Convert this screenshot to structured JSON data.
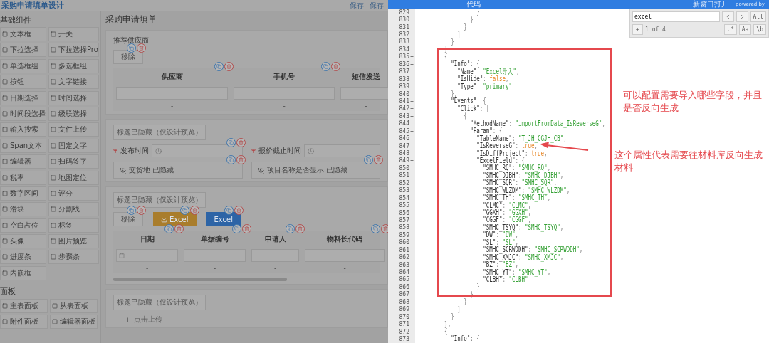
{
  "designer": {
    "title": "采购申请填单设计",
    "actions": [
      "保存",
      "保存"
    ],
    "palette": [
      {
        "title": "基础组件",
        "items": [
          "文本框",
          "开关",
          "下拉选择",
          "下拉选择Pro",
          "单选框组",
          "多选框组",
          "按钮",
          "文字链接",
          "日期选择",
          "时间选择",
          "时间段选择",
          "级联选择",
          "输入搜索",
          "文件上传",
          "Span文本",
          "固定文字",
          "编辑器",
          "扫码签字",
          "税率",
          "地图定位",
          "数字区间",
          "评分",
          "滑块",
          "分割线",
          "空白占位",
          "标签",
          "头像",
          "图片预览",
          "进度条",
          "步骤条",
          "内嵌框"
        ]
      },
      {
        "title": "面板",
        "items": [
          "主表面板",
          "从表面板",
          "附件面板",
          "编辑器面板"
        ]
      }
    ],
    "form": {
      "title": "采购申请填单",
      "supplier_section": {
        "title": "推荐供应商",
        "button": "移除",
        "columns": [
          "供应商",
          "手机号",
          "短信发送"
        ],
        "cells": [
          "-",
          "-",
          "-"
        ]
      },
      "info_section": {
        "tag": "标题已隐藏（仅设计预览）",
        "fields": [
          {
            "label": "发布时间",
            "required": true
          },
          {
            "label": "报价截止时间",
            "required": true
          }
        ],
        "hidden_fields": [
          {
            "label": "交货地",
            "status": "已隐藏"
          },
          {
            "label": "项目名称是否显示",
            "status": "已隐藏"
          }
        ]
      },
      "detail_section": {
        "tag": "标题已隐藏（仅设计预览）",
        "buttons": [
          {
            "label": "移除",
            "kind": "plain"
          },
          {
            "label": "Excel",
            "kind": "warning"
          },
          {
            "label": "Excel",
            "kind": "primary"
          }
        ],
        "columns": [
          "日期",
          "单据编号",
          "申请人",
          "物料长代码"
        ],
        "cells": [
          "-",
          "-",
          "-",
          "-"
        ]
      },
      "upload_section": {
        "tag": "标题已隐藏（仅设计预览）",
        "upload": "点击上传"
      }
    }
  },
  "code_dialog": {
    "menu": "代码",
    "open_link": "新窗口打开",
    "credit": "powered by",
    "search": {
      "value": "excel",
      "scope": "All",
      "count": "1 of 4",
      "options": [
        ".*",
        "Aa",
        "\\b"
      ]
    },
    "lines": [
      {
        "n": "829",
        "fold": false,
        "code": [
          {
            "kind": "punct",
            "text": "                  }"
          }
        ]
      },
      {
        "n": "830",
        "fold": false,
        "code": [
          {
            "kind": "punct",
            "text": "                }"
          }
        ]
      },
      {
        "n": "831",
        "fold": false,
        "code": [
          {
            "kind": "punct",
            "text": "              }"
          }
        ]
      },
      {
        "n": "832",
        "fold": false,
        "code": [
          {
            "kind": "punct",
            "text": "            ]"
          }
        ]
      },
      {
        "n": "833",
        "fold": false,
        "code": [
          {
            "kind": "punct",
            "text": "          }"
          }
        ]
      },
      {
        "n": "834",
        "fold": false,
        "code": [
          {
            "kind": "punct",
            "text": "        }"
          }
        ]
      },
      {
        "n": "835",
        "fold": true,
        "code": [
          {
            "kind": "punct",
            "text": "        {"
          }
        ]
      },
      {
        "n": "836",
        "fold": true,
        "code": [
          {
            "kind": "key",
            "text": "          \"Info\""
          },
          {
            "kind": "punct",
            "text": ": {"
          }
        ]
      },
      {
        "n": "837",
        "fold": false,
        "code": [
          {
            "kind": "key",
            "text": "            \"Name\""
          },
          {
            "kind": "punct",
            "text": ": "
          },
          {
            "kind": "string",
            "text": "\"Excel导入\""
          },
          {
            "kind": "punct",
            "text": ","
          }
        ]
      },
      {
        "n": "838",
        "fold": false,
        "code": [
          {
            "kind": "key",
            "text": "            \"IsHide\""
          },
          {
            "kind": "punct",
            "text": ": "
          },
          {
            "kind": "literal",
            "text": "false"
          },
          {
            "kind": "punct",
            "text": ","
          }
        ]
      },
      {
        "n": "839",
        "fold": false,
        "code": [
          {
            "kind": "key",
            "text": "            \"Type\""
          },
          {
            "kind": "punct",
            "text": ": "
          },
          {
            "kind": "string",
            "text": "\"primary\""
          }
        ]
      },
      {
        "n": "840",
        "fold": false,
        "code": [
          {
            "kind": "punct",
            "text": "          },"
          }
        ]
      },
      {
        "n": "841",
        "fold": true,
        "code": [
          {
            "kind": "key",
            "text": "          \"Events\""
          },
          {
            "kind": "punct",
            "text": ": {"
          }
        ]
      },
      {
        "n": "842",
        "fold": true,
        "code": [
          {
            "kind": "key",
            "text": "            \"Click\""
          },
          {
            "kind": "punct",
            "text": ": ["
          }
        ]
      },
      {
        "n": "843",
        "fold": true,
        "code": [
          {
            "kind": "punct",
            "text": "              {"
          }
        ]
      },
      {
        "n": "844",
        "fold": false,
        "code": [
          {
            "kind": "key",
            "text": "                \"MethodName\""
          },
          {
            "kind": "punct",
            "text": ": "
          },
          {
            "kind": "string",
            "text": "\"importFromData_IsReverseG\""
          },
          {
            "kind": "punct",
            "text": ","
          }
        ]
      },
      {
        "n": "845",
        "fold": true,
        "code": [
          {
            "kind": "key",
            "text": "                \"Param\""
          },
          {
            "kind": "punct",
            "text": ": {"
          }
        ]
      },
      {
        "n": "846",
        "fold": false,
        "code": [
          {
            "kind": "key",
            "text": "                  \"TableName\""
          },
          {
            "kind": "punct",
            "text": ": "
          },
          {
            "kind": "string",
            "text": "\"T_JH_CGJH_CB\""
          },
          {
            "kind": "punct",
            "text": ","
          }
        ]
      },
      {
        "n": "847",
        "fold": false,
        "code": [
          {
            "kind": "key",
            "text": "                  \"IsReverseG\""
          },
          {
            "kind": "punct",
            "text": ": "
          },
          {
            "kind": "literal",
            "text": "true"
          },
          {
            "kind": "punct",
            "text": ","
          }
        ]
      },
      {
        "n": "848",
        "fold": false,
        "code": [
          {
            "kind": "key",
            "text": "                  \"IsDiffProject\""
          },
          {
            "kind": "punct",
            "text": ": "
          },
          {
            "kind": "literal",
            "text": "true"
          },
          {
            "kind": "punct",
            "text": ","
          }
        ]
      },
      {
        "n": "849",
        "fold": true,
        "code": [
          {
            "kind": "key",
            "text": "                  \"ExcelField\""
          },
          {
            "kind": "punct",
            "text": ": {"
          }
        ]
      },
      {
        "n": "850",
        "fold": false,
        "code": [
          {
            "kind": "key",
            "text": "                    \"SMHC_RQ\""
          },
          {
            "kind": "punct",
            "text": ": "
          },
          {
            "kind": "string",
            "text": "\"SMHC_RQ\""
          },
          {
            "kind": "punct",
            "text": ","
          }
        ]
      },
      {
        "n": "851",
        "fold": false,
        "code": [
          {
            "kind": "key",
            "text": "                    \"SMHC_DJBH\""
          },
          {
            "kind": "punct",
            "text": ": "
          },
          {
            "kind": "string",
            "text": "\"SMHC_DJBH\""
          },
          {
            "kind": "punct",
            "text": ","
          }
        ]
      },
      {
        "n": "852",
        "fold": false,
        "code": [
          {
            "kind": "key",
            "text": "                    \"SMHC_SQR\""
          },
          {
            "kind": "punct",
            "text": ": "
          },
          {
            "kind": "string",
            "text": "\"SMHC_SQR\""
          },
          {
            "kind": "punct",
            "text": ","
          }
        ]
      },
      {
        "n": "853",
        "fold": false,
        "code": [
          {
            "kind": "key",
            "text": "                    \"SMHC_WLZDM\""
          },
          {
            "kind": "punct",
            "text": ": "
          },
          {
            "kind": "string",
            "text": "\"SMHC_WLZDM\""
          },
          {
            "kind": "punct",
            "text": ","
          }
        ]
      },
      {
        "n": "854",
        "fold": false,
        "code": [
          {
            "kind": "key",
            "text": "                    \"SMHC_TH\""
          },
          {
            "kind": "punct",
            "text": ": "
          },
          {
            "kind": "string",
            "text": "\"SMHC_TH\""
          },
          {
            "kind": "punct",
            "text": ","
          }
        ]
      },
      {
        "n": "855",
        "fold": false,
        "code": [
          {
            "kind": "key",
            "text": "                    \"CLMC\""
          },
          {
            "kind": "punct",
            "text": ": "
          },
          {
            "kind": "string",
            "text": "\"CLMC\""
          },
          {
            "kind": "punct",
            "text": ","
          }
        ]
      },
      {
        "n": "856",
        "fold": false,
        "code": [
          {
            "kind": "key",
            "text": "                    \"GGXH\""
          },
          {
            "kind": "punct",
            "text": ": "
          },
          {
            "kind": "string",
            "text": "\"GGXH\""
          },
          {
            "kind": "punct",
            "text": ","
          }
        ]
      },
      {
        "n": "857",
        "fold": false,
        "code": [
          {
            "kind": "key",
            "text": "                    \"CGGF\""
          },
          {
            "kind": "punct",
            "text": ": "
          },
          {
            "kind": "string",
            "text": "\"CGGF\""
          },
          {
            "kind": "punct",
            "text": ","
          }
        ]
      },
      {
        "n": "858",
        "fold": false,
        "code": [
          {
            "kind": "key",
            "text": "                    \"SMHC_TSYQ\""
          },
          {
            "kind": "punct",
            "text": ": "
          },
          {
            "kind": "string",
            "text": "\"SMHC_TSYQ\""
          },
          {
            "kind": "punct",
            "text": ","
          }
        ]
      },
      {
        "n": "859",
        "fold": false,
        "code": [
          {
            "kind": "key",
            "text": "                    \"DW\""
          },
          {
            "kind": "punct",
            "text": ": "
          },
          {
            "kind": "string",
            "text": "\"DW\""
          },
          {
            "kind": "punct",
            "text": ","
          }
        ]
      },
      {
        "n": "860",
        "fold": false,
        "code": [
          {
            "kind": "key",
            "text": "                    \"SL\""
          },
          {
            "kind": "punct",
            "text": ": "
          },
          {
            "kind": "string",
            "text": "\"SL\""
          },
          {
            "kind": "punct",
            "text": ","
          }
        ]
      },
      {
        "n": "861",
        "fold": false,
        "code": [
          {
            "kind": "key",
            "text": "                    \"SMHC_SCRWDDH\""
          },
          {
            "kind": "punct",
            "text": ": "
          },
          {
            "kind": "string",
            "text": "\"SMHC_SCRWDDH\""
          },
          {
            "kind": "punct",
            "text": ","
          }
        ]
      },
      {
        "n": "862",
        "fold": false,
        "code": [
          {
            "kind": "key",
            "text": "                    \"SMHC_XMJC\""
          },
          {
            "kind": "punct",
            "text": ": "
          },
          {
            "kind": "string",
            "text": "\"SMHC_XMJC\""
          },
          {
            "kind": "punct",
            "text": ","
          }
        ]
      },
      {
        "n": "863",
        "fold": false,
        "code": [
          {
            "kind": "key",
            "text": "                    \"BZ\""
          },
          {
            "kind": "punct",
            "text": ": "
          },
          {
            "kind": "string",
            "text": "\"BZ\""
          },
          {
            "kind": "punct",
            "text": ","
          }
        ]
      },
      {
        "n": "864",
        "fold": false,
        "code": [
          {
            "kind": "key",
            "text": "                    \"SMHC_YT\""
          },
          {
            "kind": "punct",
            "text": ": "
          },
          {
            "kind": "string",
            "text": "\"SMHC_YT\""
          },
          {
            "kind": "punct",
            "text": ","
          }
        ]
      },
      {
        "n": "865",
        "fold": false,
        "code": [
          {
            "kind": "key",
            "text": "                    \"CLBH\""
          },
          {
            "kind": "punct",
            "text": ": "
          },
          {
            "kind": "string",
            "text": "\"CLBH\""
          }
        ]
      },
      {
        "n": "866",
        "fold": false,
        "code": [
          {
            "kind": "punct",
            "text": "                  }"
          }
        ]
      },
      {
        "n": "867",
        "fold": false,
        "code": [
          {
            "kind": "punct",
            "text": "                }"
          }
        ]
      },
      {
        "n": "868",
        "fold": false,
        "code": [
          {
            "kind": "punct",
            "text": "              }"
          }
        ]
      },
      {
        "n": "869",
        "fold": false,
        "code": [
          {
            "kind": "punct",
            "text": "            ]"
          }
        ]
      },
      {
        "n": "870",
        "fold": false,
        "code": [
          {
            "kind": "punct",
            "text": "          }"
          }
        ]
      },
      {
        "n": "871",
        "fold": false,
        "code": [
          {
            "kind": "punct",
            "text": "        },"
          }
        ]
      },
      {
        "n": "872",
        "fold": true,
        "code": [
          {
            "kind": "punct",
            "text": "        {"
          }
        ]
      },
      {
        "n": "873",
        "fold": true,
        "code": [
          {
            "kind": "key",
            "text": "          \"Info\""
          },
          {
            "kind": "punct",
            "text": ": {"
          }
        ]
      }
    ],
    "notes": [
      "可以配置需要导入哪些字段，并且是否反向生成",
      "这个属性代表需要往材料库反向生成材料"
    ]
  }
}
